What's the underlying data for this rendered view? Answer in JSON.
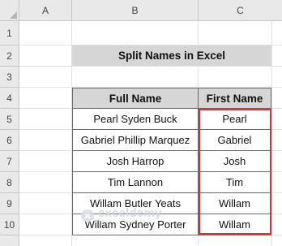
{
  "spreadsheet": {
    "columns": [
      "A",
      "B",
      "C"
    ],
    "rows": [
      "1",
      "2",
      "3",
      "4",
      "5",
      "6",
      "7",
      "8",
      "9",
      "10"
    ],
    "title": "Split Names in Excel",
    "table": {
      "headers": [
        "Full Name",
        "First Name"
      ],
      "rows": [
        [
          "Pearl Syden Buck",
          "Pearl"
        ],
        [
          "Gabriel Phillip Marquez",
          "Gabriel"
        ],
        [
          "Josh Harrop",
          "Josh"
        ],
        [
          "Tim Lannon",
          "Tim"
        ],
        [
          "Willam Butler Yeats",
          "Willam"
        ],
        [
          "Willam Sydney Porter",
          "Willam"
        ]
      ]
    },
    "highlight_color": "#e0312e",
    "header_fill": "#d6d6d6"
  },
  "watermark": {
    "brand": "exceldemy",
    "tagline": "EXCEL · DATA · BI"
  }
}
